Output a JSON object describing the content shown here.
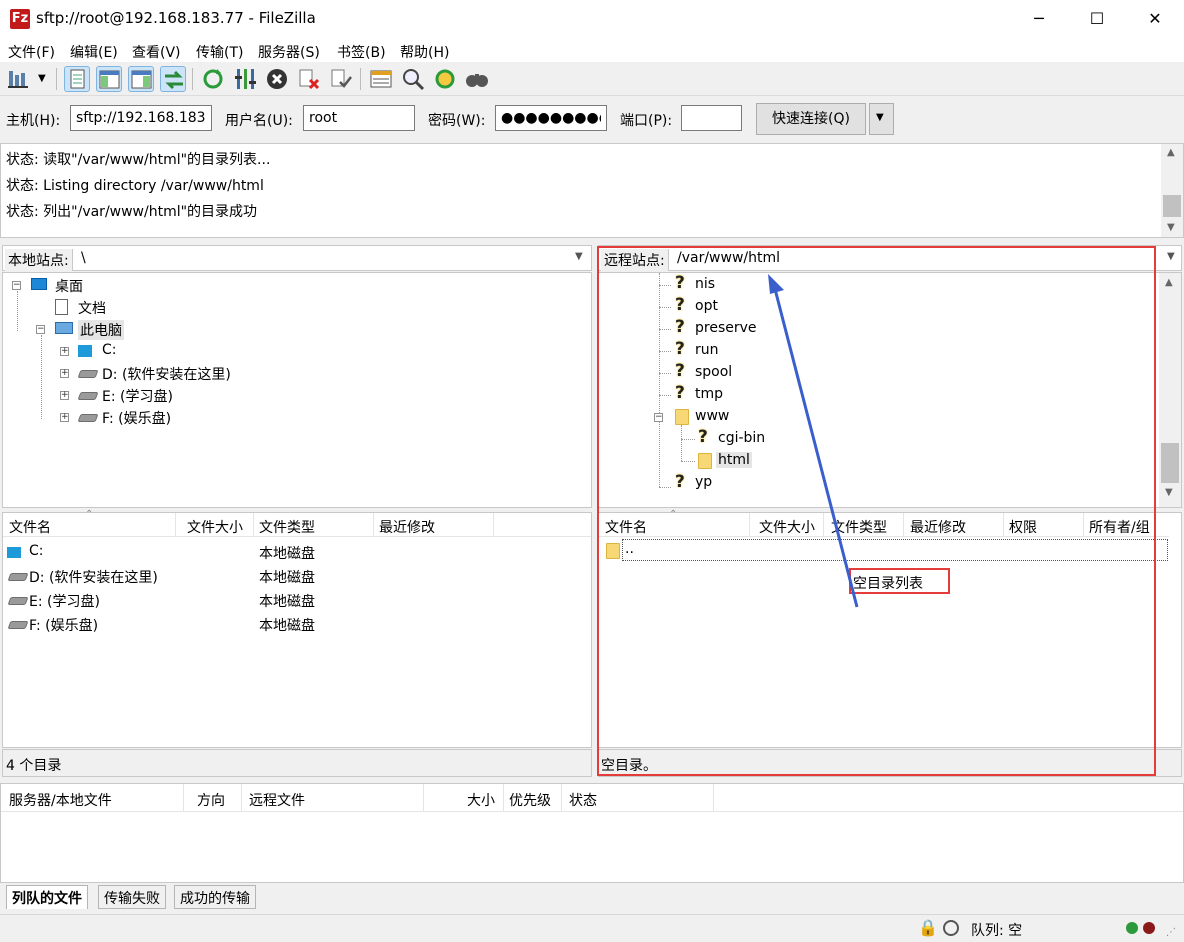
{
  "window": {
    "title": "sftp://root@192.168.183.77 - FileZilla",
    "app_icon": "Fz"
  },
  "menu": [
    "文件(F)",
    "编辑(E)",
    "查看(V)",
    "传输(T)",
    "服务器(S)",
    "书签(B)",
    "帮助(H)"
  ],
  "quickconnect": {
    "host_label": "主机(H):",
    "host_value": "sftp://192.168.183",
    "user_label": "用户名(U):",
    "user_value": "root",
    "pass_label": "密码(W):",
    "pass_value": "●●●●●●●●●●",
    "port_label": "端口(P):",
    "port_value": "",
    "button": "快速连接(Q)"
  },
  "log": [
    "状态:  读取\"/var/www/html\"的目录列表...",
    "状态:  Listing directory /var/www/html",
    "状态:  列出\"/var/www/html\"的目录成功"
  ],
  "local": {
    "label": "本地站点:",
    "path": "\\",
    "tree": [
      "桌面",
      "文档",
      "此电脑",
      "C:",
      "D: (软件安装在这里)",
      "E: (学习盘)",
      "F: (娱乐盘)"
    ],
    "columns": [
      "文件名",
      "文件大小",
      "文件类型",
      "最近修改"
    ],
    "rows": [
      {
        "name": "C:",
        "type": "本地磁盘"
      },
      {
        "name": "D: (软件安装在这里)",
        "type": "本地磁盘"
      },
      {
        "name": "E: (学习盘)",
        "type": "本地磁盘"
      },
      {
        "name": "F: (娱乐盘)",
        "type": "本地磁盘"
      }
    ],
    "status": "4 个目录"
  },
  "remote": {
    "label": "远程站点:",
    "path": "/var/www/html",
    "tree": [
      "nis",
      "opt",
      "preserve",
      "run",
      "spool",
      "tmp",
      "www",
      "cgi-bin",
      "html",
      "yp"
    ],
    "columns": [
      "文件名",
      "文件大小",
      "文件类型",
      "最近修改",
      "权限",
      "所有者/组"
    ],
    "parent_row": "..",
    "empty_text": "空目录列表",
    "status": "空目录。"
  },
  "queue": {
    "columns": [
      "服务器/本地文件",
      "方向",
      "远程文件",
      "大小",
      "优先级",
      "状态"
    ],
    "tabs": [
      "列队的文件",
      "传输失败",
      "成功的传输"
    ]
  },
  "statusbar": {
    "queue": "队列: 空"
  },
  "colors": {
    "annotation": "#e43b3b",
    "arrow": "#3a5fcd",
    "selected": "#cce4f7"
  }
}
